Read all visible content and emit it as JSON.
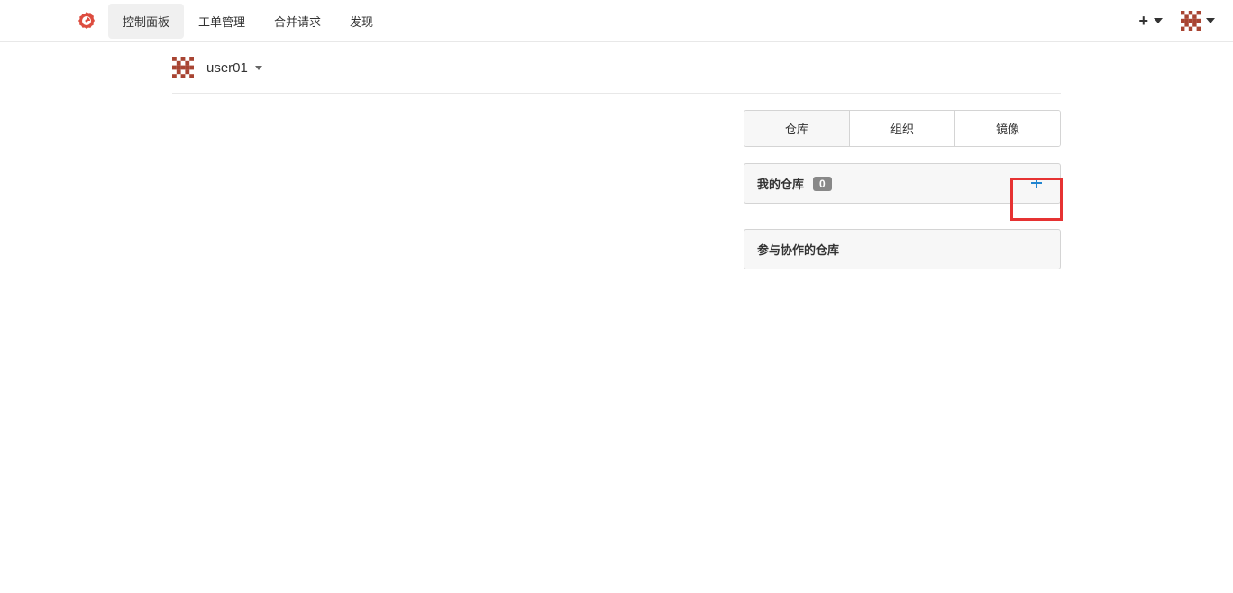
{
  "nav": {
    "items": [
      {
        "label": "控制面板",
        "active": true
      },
      {
        "label": "工单管理",
        "active": false
      },
      {
        "label": "合并请求",
        "active": false
      },
      {
        "label": "发现",
        "active": false
      }
    ]
  },
  "user": {
    "name": "user01"
  },
  "tabs": {
    "items": [
      {
        "label": "仓库",
        "active": true
      },
      {
        "label": "组织",
        "active": false
      },
      {
        "label": "镜像",
        "active": false
      }
    ]
  },
  "panels": {
    "my_repos": {
      "title": "我的仓库",
      "count": "0"
    },
    "collab_repos": {
      "title": "参与协作的仓库"
    }
  }
}
